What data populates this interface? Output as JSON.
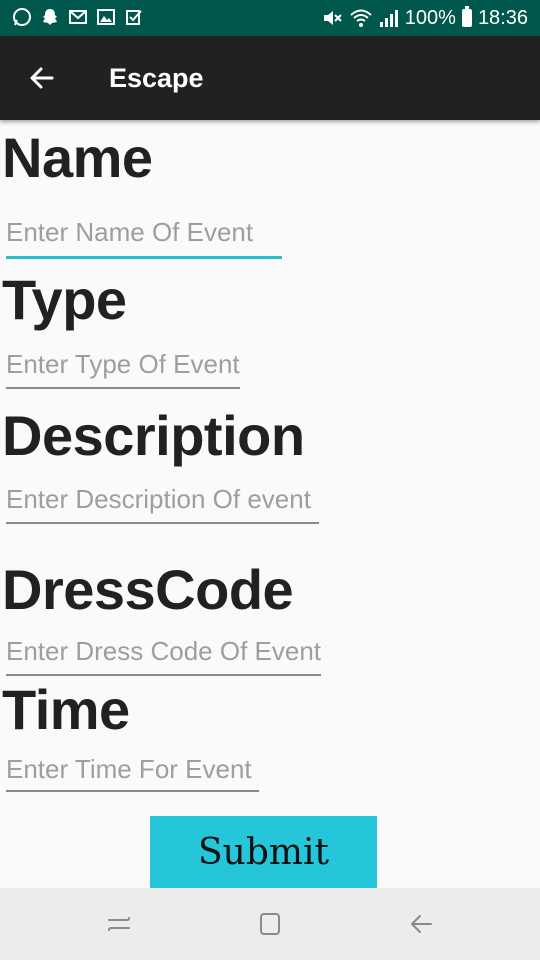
{
  "status_bar": {
    "battery": "100%",
    "time": "18:36",
    "notification_icons": [
      "whatsapp-icon",
      "snapchat-icon",
      "gmail-icon",
      "gallery-icon",
      "task-icon"
    ],
    "system_icons": [
      "mute-icon",
      "wifi-icon",
      "signal-icon",
      "battery-icon"
    ]
  },
  "app_bar": {
    "title": "Escape",
    "background": "#212121"
  },
  "form": {
    "name": {
      "label": "Name",
      "placeholder": "Enter Name Of Event"
    },
    "type": {
      "label": "Type",
      "placeholder": "Enter Type Of Event"
    },
    "description": {
      "label": "Description",
      "placeholder": "Enter Description Of event"
    },
    "dress_code": {
      "label": "DressCode",
      "placeholder": "Enter Dress Code Of Event"
    },
    "time": {
      "label": "Time",
      "placeholder": "Enter Time For Event"
    }
  },
  "submit": {
    "label": "Submit",
    "color": "#26c6da"
  },
  "colors": {
    "status_bar": "#00574b",
    "accent": "#26c0cd"
  },
  "nav_bar": {
    "buttons": [
      "recent-apps-icon",
      "home-icon",
      "back-icon"
    ]
  }
}
